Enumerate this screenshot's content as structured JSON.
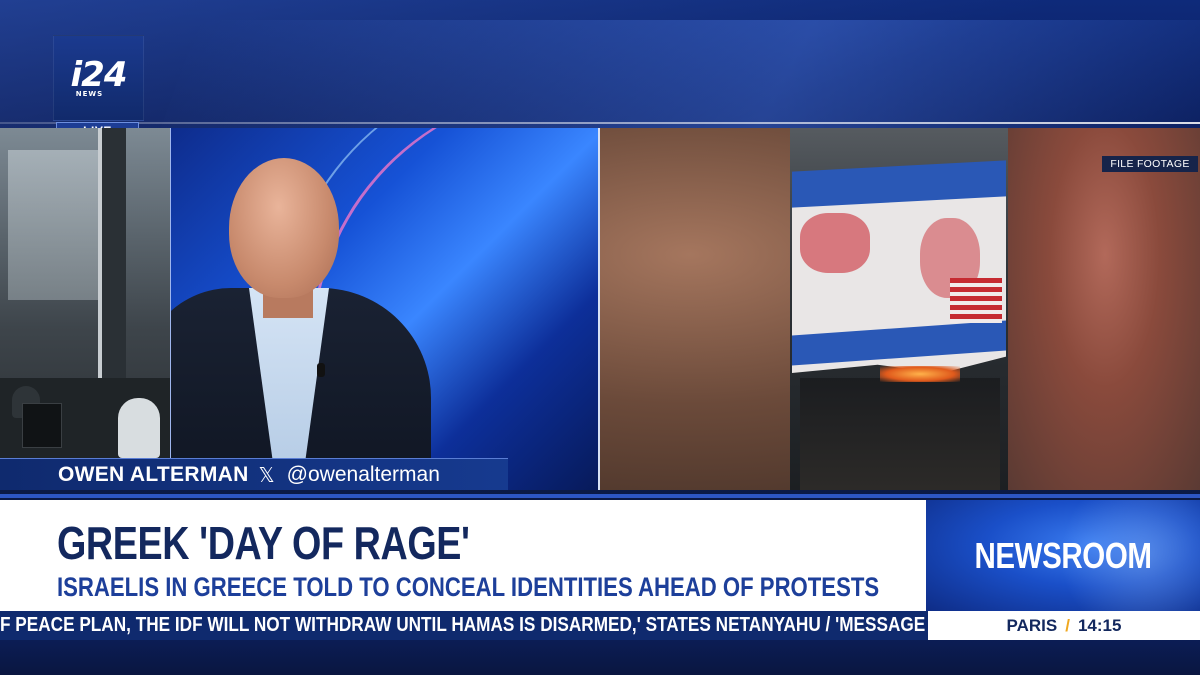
{
  "brand": {
    "logo_main": "i24",
    "logo_sub": "NEWS",
    "live_label": "LIVE"
  },
  "footage": {
    "tag": "FILE FOOTAGE"
  },
  "guest": {
    "name": "OWEN ALTERMAN",
    "x_icon": "𝕏",
    "handle": "@owenalterman"
  },
  "lower_third": {
    "headline": "GREEK 'DAY OF RAGE'",
    "subheadline": "ISRAELIS IN GREECE TOLD TO CONCEAL IDENTITIES AHEAD OF PROTESTS"
  },
  "program": {
    "name": "NEWSROOM"
  },
  "ticker": {
    "text": "F PEACE PLAN, THE IDF WILL NOT WITHDRAW UNTIL HAMAS IS DISARMED,' STATES NETANYAHU  /  'MESSAGE"
  },
  "clock": {
    "city": "PARIS",
    "separator": "/",
    "time": "14:15"
  },
  "colors": {
    "brand_blue": "#0f2a6e",
    "headline_navy": "#13285e",
    "accent_yellow": "#f0a820"
  }
}
